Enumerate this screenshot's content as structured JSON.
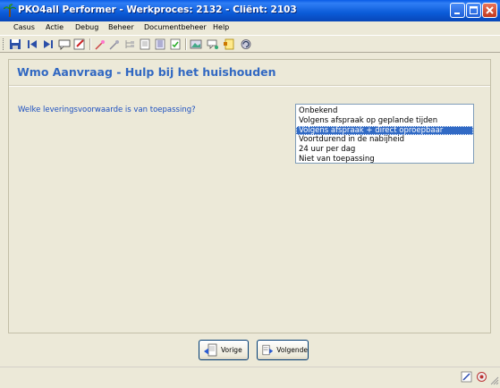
{
  "window": {
    "title": "PKO4all Performer - Werkproces: 2132 - Cliënt: 2103",
    "app_icon": "palm-tree-icon",
    "title_color": "#0a5ce6"
  },
  "menu": {
    "items": [
      "Casus",
      "Actie",
      "Debug",
      "Beheer",
      "Documentbeheer",
      "Help"
    ]
  },
  "toolbar": {
    "icons": [
      "save-icon",
      "first-icon",
      "last-icon",
      "comment-icon",
      "edit-icon",
      "magic-wand-icon",
      "magic-wand-2-icon",
      "tree-icon",
      "document-icon",
      "list-icon",
      "check-document-icon",
      "image-icon",
      "chat-icon",
      "note-icon",
      "refresh-icon"
    ]
  },
  "form": {
    "title": "Wmo Aanvraag - Hulp bij het huishouden",
    "question": "Welke leveringsvoorwaarde is van toepassing?",
    "options": [
      "Onbekend",
      "Volgens afspraak op geplande tijden",
      "Volgens afspraak + direct oproepbaar",
      "Voortdurend in de nabijheid",
      "24 uur per dag",
      "Niet van toepassing"
    ],
    "selected_index": 2,
    "title_color": "#3168c2",
    "selection_color": "#316ac5"
  },
  "nav": {
    "prev_label": "Vorige",
    "next_label": "Volgende"
  },
  "statusbar": {
    "icons": [
      "edit-status-icon",
      "settings-status-icon"
    ]
  }
}
